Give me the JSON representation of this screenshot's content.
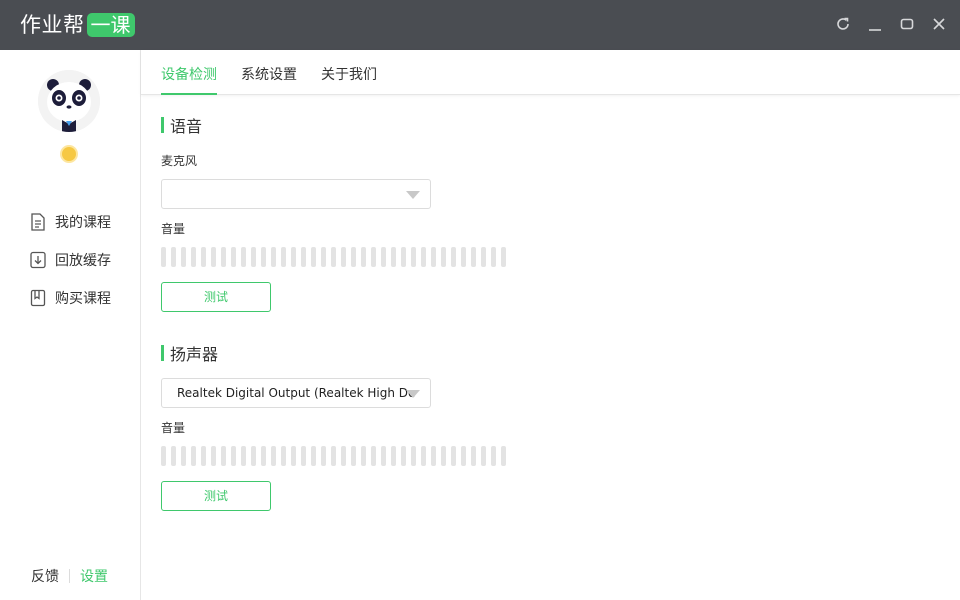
{
  "app": {
    "logo_main": "作业帮",
    "logo_badge": "一课"
  },
  "window_controls": [
    "refresh-icon",
    "minimize-icon",
    "maximize-icon",
    "close-icon"
  ],
  "sidebar": {
    "items": [
      {
        "label": "我的课程",
        "icon": "document-icon"
      },
      {
        "label": "回放缓存",
        "icon": "download-icon"
      },
      {
        "label": "购买课程",
        "icon": "bookmark-icon"
      }
    ],
    "footer": {
      "feedback": "反馈",
      "settings": "设置"
    }
  },
  "tabs": [
    {
      "label": "设备检测",
      "active": true
    },
    {
      "label": "系统设置",
      "active": false
    },
    {
      "label": "关于我们",
      "active": false
    }
  ],
  "voice": {
    "title": "语音",
    "mic_label": "麦克风",
    "mic_value": "",
    "volume_label": "音量",
    "volume_level": 0,
    "test_label": "测试"
  },
  "speaker": {
    "title": "扬声器",
    "device_value": "Realtek Digital Output (Realtek High Definition Audio)",
    "volume_label": "音量",
    "volume_level": 0,
    "test_label": "测试"
  },
  "colors": {
    "accent": "#3fc86c",
    "titlebar": "#4a4d52"
  }
}
